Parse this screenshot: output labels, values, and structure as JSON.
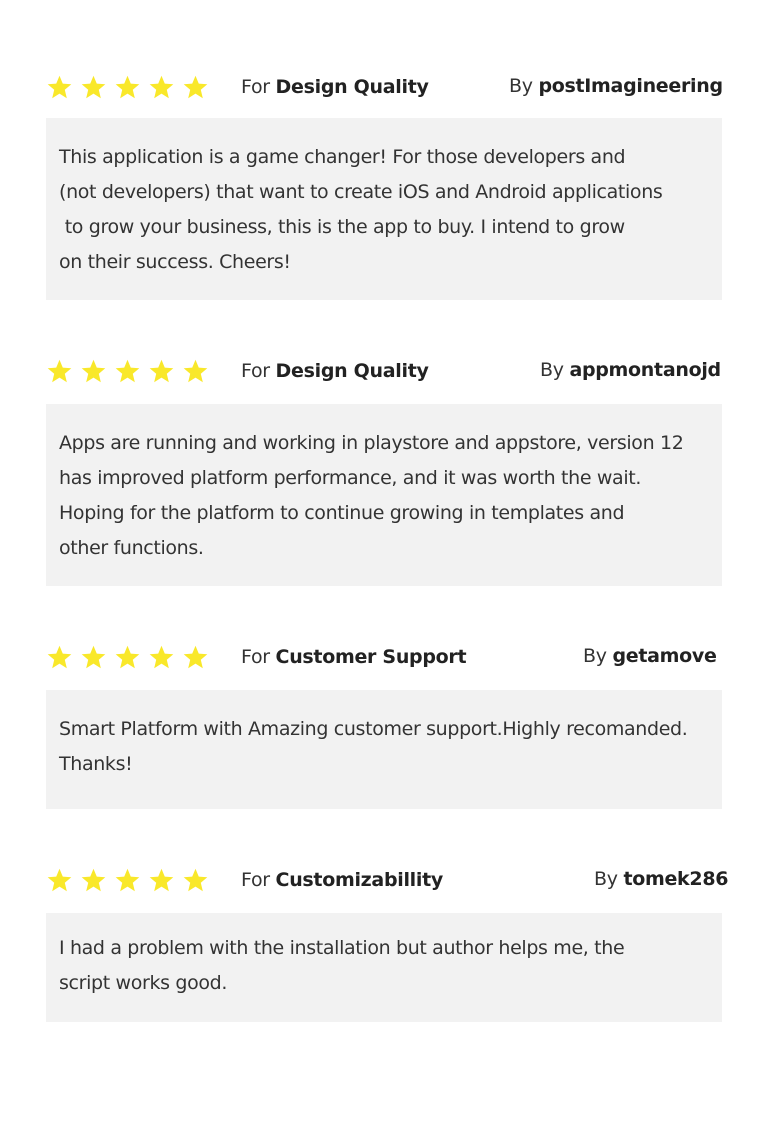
{
  "star_color": "#f9e82a",
  "body_background": "#f2f2f2",
  "reviews": [
    {
      "rating": 5,
      "max_rating": 5,
      "for_prefix": "For",
      "category": "Design Quality",
      "by_prefix": "By",
      "author": "postImagineering",
      "lines": [
        "This application is a game changer! For those developers and",
        "(not developers) that want to create iOS and Android applications",
        " to grow your business, this is the app to buy. I intend to grow",
        "on their success. Cheers!"
      ]
    },
    {
      "rating": 5,
      "max_rating": 5,
      "for_prefix": "For",
      "category": "Design Quality",
      "by_prefix": "By",
      "author": "appmontanojd",
      "lines": [
        "Apps are running and working in playstore and appstore, version 12",
        "has improved platform performance, and it was worth the wait.",
        "Hoping for the platform to continue growing in templates and",
        "other functions."
      ]
    },
    {
      "rating": 5,
      "max_rating": 5,
      "for_prefix": "For",
      "category": "Customer Support",
      "by_prefix": "By",
      "author": "getamove",
      "lines": [
        "Smart Platform with Amazing customer support.Highly recomanded.",
        "Thanks!"
      ]
    },
    {
      "rating": 5,
      "max_rating": 5,
      "for_prefix": "For",
      "category": "Customizabillity",
      "by_prefix": "By",
      "author": "tomek286",
      "lines": [
        "I had a problem with the installation but author helps me, the",
        "script works good."
      ]
    }
  ]
}
